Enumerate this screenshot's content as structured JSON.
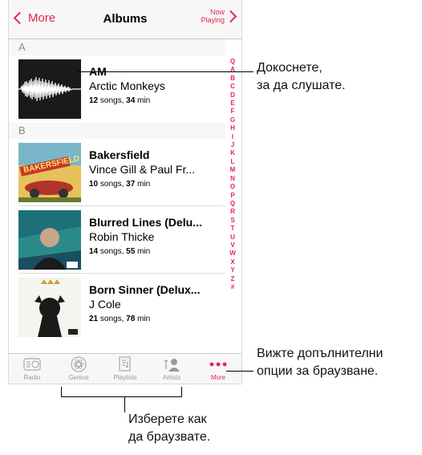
{
  "nav": {
    "back_label": "More",
    "title": "Albums",
    "now_playing": "Now Playing"
  },
  "sections": [
    "A",
    "B"
  ],
  "albums": [
    {
      "title": "AM",
      "artist": "Arctic Monkeys",
      "songs": "12",
      "songs_word": "songs,",
      "minutes": "34",
      "min_word": "min"
    },
    {
      "title": "Bakersfield",
      "artist": "Vince Gill & Paul Fr...",
      "songs": "10",
      "songs_word": "songs,",
      "minutes": "37",
      "min_word": "min"
    },
    {
      "title": "Blurred Lines (Delu...",
      "artist": "Robin Thicke",
      "songs": "14",
      "songs_word": "songs,",
      "minutes": "55",
      "min_word": "min"
    },
    {
      "title": "Born Sinner (Delux...",
      "artist": "J Cole",
      "songs": "21",
      "songs_word": "songs,",
      "minutes": "78",
      "min_word": "min"
    }
  ],
  "index_letters": [
    "Q",
    "A",
    "B",
    "C",
    "D",
    "E",
    "F",
    "G",
    "H",
    "I",
    "J",
    "K",
    "L",
    "M",
    "N",
    "O",
    "P",
    "Q",
    "R",
    "S",
    "T",
    "U",
    "V",
    "W",
    "X",
    "Y",
    "Z",
    "#"
  ],
  "tabs": [
    {
      "label": "Radio",
      "icon": "radio-icon"
    },
    {
      "label": "Genius",
      "icon": "genius-atom-icon"
    },
    {
      "label": "Playlists",
      "icon": "playlists-icon"
    },
    {
      "label": "Artists",
      "icon": "artists-icon"
    },
    {
      "label": "More",
      "icon": "more-dots-icon"
    }
  ],
  "callouts": {
    "tap_line1": "Докоснете,",
    "tap_line2": "за да слушате.",
    "more_line1": "Вижте допълнителни",
    "more_line2": "опции за браузване.",
    "browse_line1": "Изберете как",
    "browse_line2": "да браузвате."
  },
  "colors": {
    "accent": "#e8244d",
    "bar": "#f7f7f7",
    "inactive": "#9a9a9a"
  }
}
